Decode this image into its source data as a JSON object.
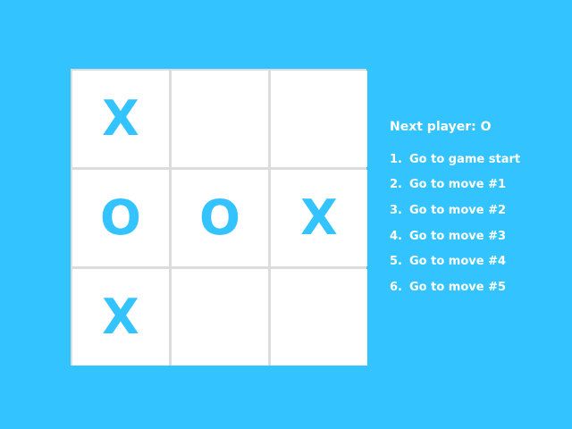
{
  "colors": {
    "background": "#33c4ff",
    "mark": "#33c4ff",
    "square": "#ffffff",
    "grid": "#dcdcdc",
    "text": "#ffffff"
  },
  "board": {
    "squares": [
      "X",
      "",
      "",
      "O",
      "O",
      "X",
      "X",
      "",
      ""
    ]
  },
  "status": "Next player: O",
  "moves": [
    {
      "number": "1.",
      "label": "Go to game start"
    },
    {
      "number": "2.",
      "label": "Go to move #1"
    },
    {
      "number": "3.",
      "label": "Go to move #2"
    },
    {
      "number": "4.",
      "label": "Go to move #3"
    },
    {
      "number": "5.",
      "label": "Go to move #4"
    },
    {
      "number": "6.",
      "label": "Go to move #5"
    }
  ]
}
